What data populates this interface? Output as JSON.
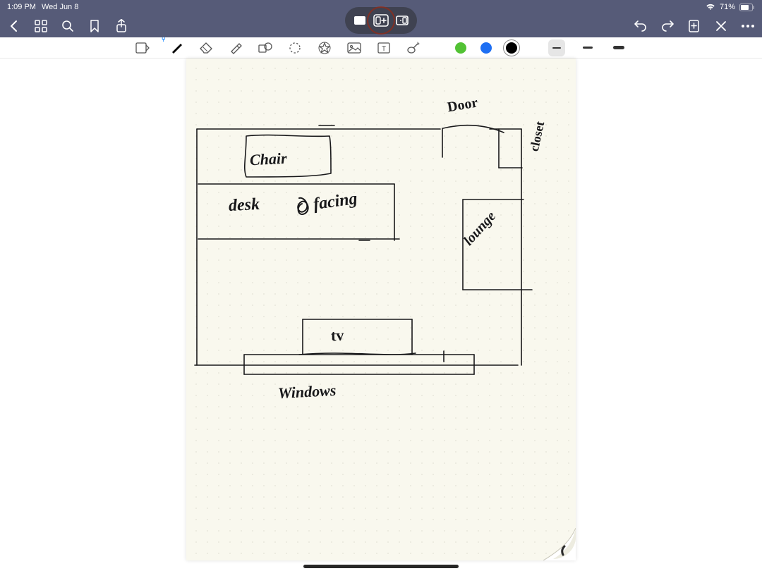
{
  "status": {
    "time": "1:09 PM",
    "date": "Wed Jun 8",
    "wifi_icon": "wifi",
    "battery_pct": "71%"
  },
  "multitask": {
    "left_icon": "fullscreen",
    "center_icon": "split-view-add",
    "right_icon": "slide-over"
  },
  "nav": {
    "back_icon": "chevron-left",
    "grid_icon": "thumbnails",
    "search_icon": "search",
    "bookmark_icon": "bookmark",
    "share_icon": "share",
    "undo_icon": "undo",
    "redo_icon": "redo",
    "add_icon": "add-page",
    "close_icon": "close",
    "more_icon": "more"
  },
  "tools": {
    "readonly_icon": "read-mode",
    "bluetooth_badge": "bluetooth",
    "pen_icon": "pen",
    "eraser_icon": "eraser",
    "highlighter_icon": "highlighter",
    "shape_icon": "shapes",
    "lasso_icon": "lasso",
    "favorites_icon": "favorites",
    "image_icon": "image",
    "text_icon": "text-box",
    "wand_icon": "auto-wand",
    "colors": {
      "green": "#52c234",
      "blue": "#1e6ff3",
      "black": "#000000",
      "selected": "black"
    },
    "strokes": {
      "selected": "thin"
    }
  },
  "canvas": {
    "labels": {
      "chair": "Chair",
      "desk": "desk",
      "facing": "facing",
      "tv": "tv",
      "windows": "Windows",
      "door": "Door",
      "closet": "closet",
      "lounge": "lounge"
    }
  }
}
